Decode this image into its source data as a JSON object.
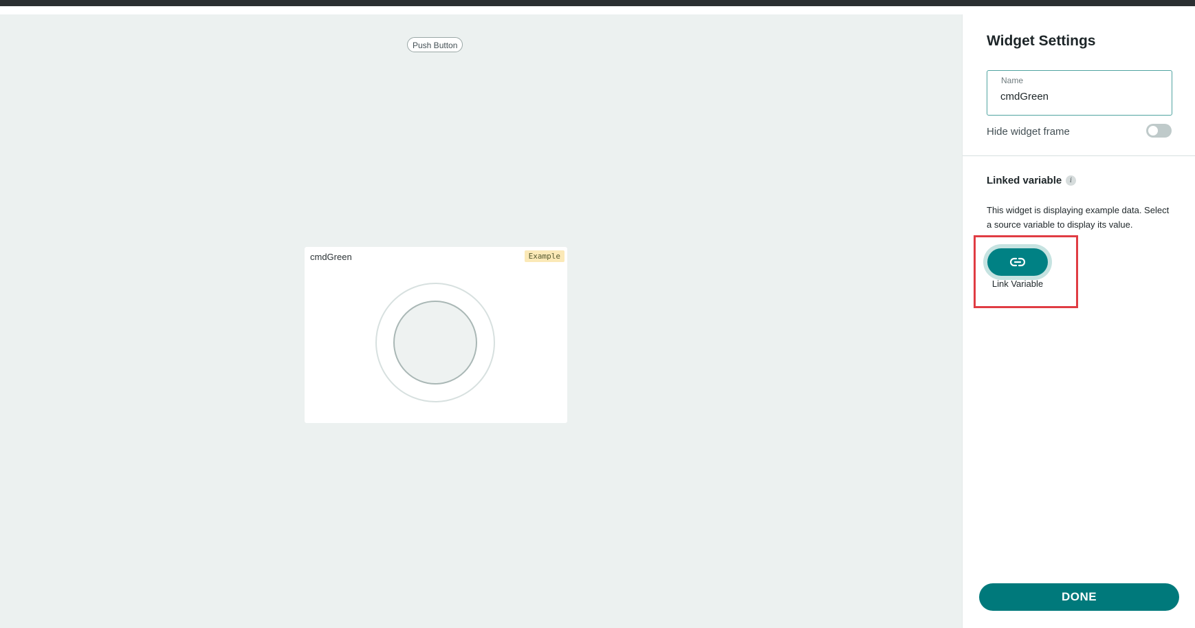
{
  "canvas": {
    "widget_type_badge": "Push Button",
    "widget": {
      "title": "cmdGreen",
      "badge": "Example"
    }
  },
  "settings_panel": {
    "title": "Widget Settings",
    "name_field": {
      "label": "Name",
      "value": "cmdGreen"
    },
    "hide_widget_frame": {
      "label": "Hide widget frame",
      "enabled": false
    },
    "linked_variable": {
      "title": "Linked variable",
      "info_icon": "info-icon",
      "description": "This widget is displaying example data. Select a source variable to display its value.",
      "link_button_icon": "link-icon",
      "link_button_label": "Link Variable"
    },
    "done_label": "DONE"
  },
  "colors": {
    "accent": "#008184",
    "canvas_bg": "#ecf1f0",
    "highlight": "#e03c43",
    "example_badge_bg": "#fbe9b7"
  }
}
